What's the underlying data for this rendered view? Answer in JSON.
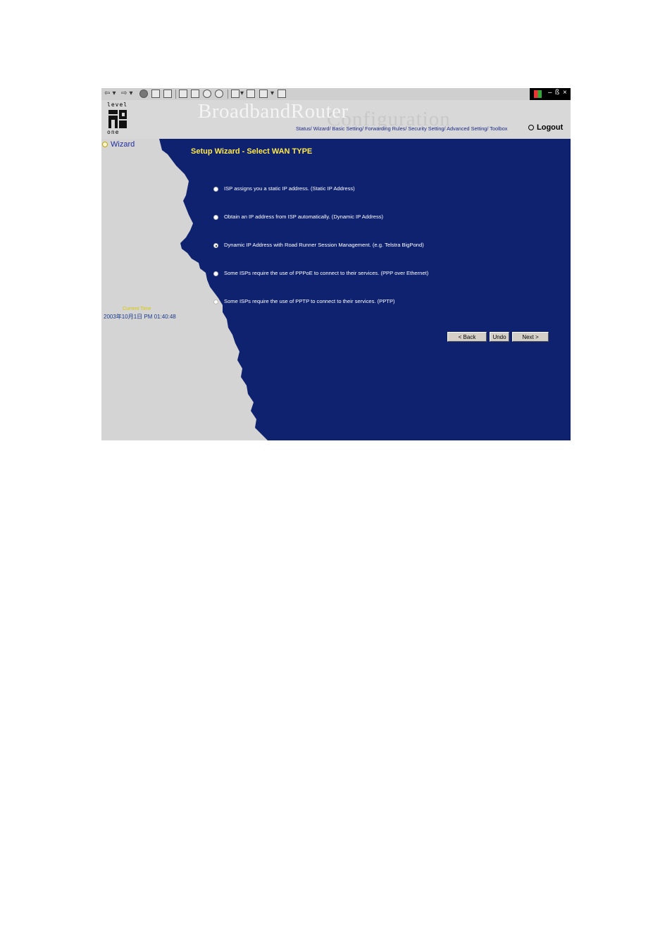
{
  "toolbar": {
    "icons": [
      "back-icon",
      "forward-icon",
      "stop-icon",
      "refresh-icon",
      "home-icon",
      "search-icon",
      "favorites-icon",
      "history-icon",
      "channels-icon",
      "mail-icon",
      "print-icon",
      "edit-icon",
      "discuss-icon"
    ]
  },
  "window_controls": {
    "minimize": "–",
    "restore": "ß",
    "close": "×"
  },
  "header": {
    "logo_top": "level",
    "logo_bottom": "one",
    "brand": "BroadbandRouter",
    "brand_sub": "Configuration",
    "nav": "Status/ Wizard/ Basic Setting/ Forwarding Rules/ Security Setting/ Advanced Setting/ Toolbox",
    "logout": "Logout"
  },
  "sidebar": {
    "wizard": "Wizard",
    "current_time_label": "Current Time",
    "current_time_value": "2003年10月1日 PM 01:40:48"
  },
  "main": {
    "title": "Setup Wizard - Select WAN TYPE",
    "options": [
      {
        "label": "ISP assigns you a static IP address. (Static IP Address)",
        "selected": false
      },
      {
        "label": "Obtain an IP address from ISP automatically. (Dynamic IP Address)",
        "selected": false
      },
      {
        "label": "Dynamic IP Address with Road Runner Session Management. (e.g. Telstra BigPond)",
        "selected": true
      },
      {
        "label": "Some ISPs require the use of PPPoE to connect to their services. (PPP over Ethernet)",
        "selected": false
      },
      {
        "label": "Some ISPs require the use of PPTP to connect to their services. (PPTP)",
        "selected": false
      }
    ],
    "buttons": {
      "back": "< Back",
      "undo": "Undo",
      "next": "Next >"
    }
  },
  "colors": {
    "ocean": "#0f2270",
    "land": "#d4d4d4",
    "title": "#ffe84a"
  }
}
